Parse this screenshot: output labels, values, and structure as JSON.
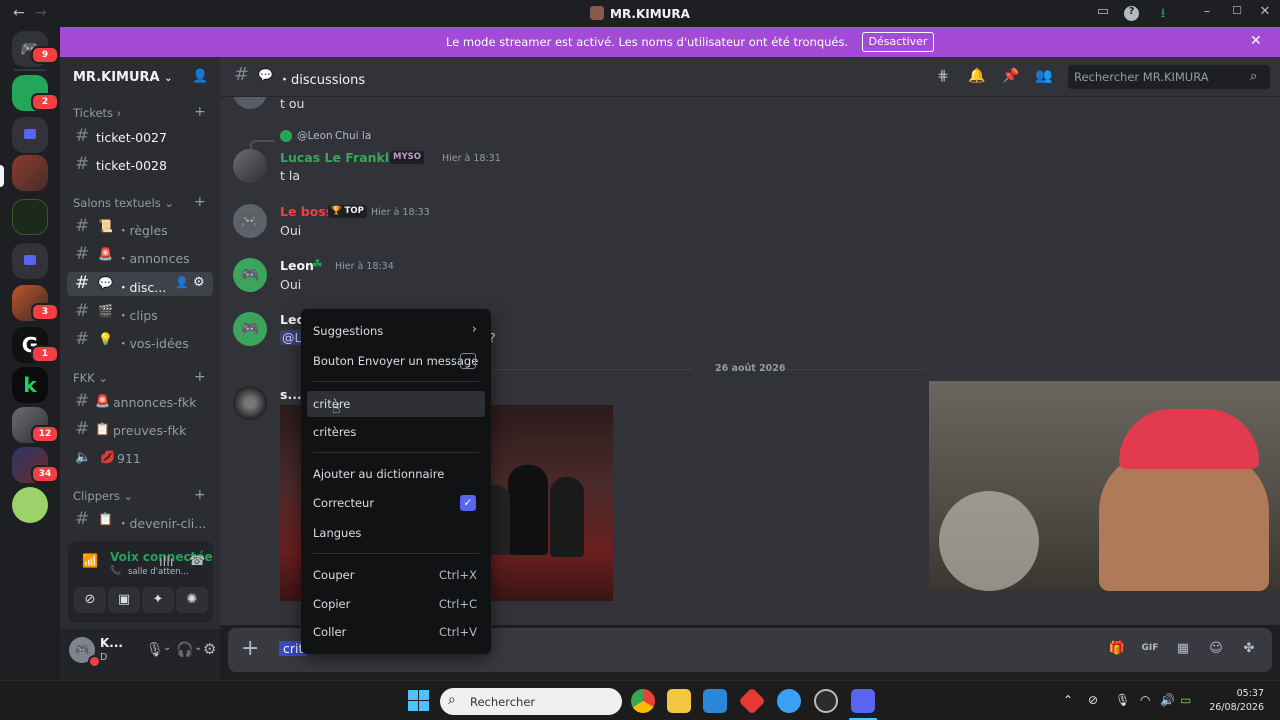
{
  "window": {
    "title": "MR.KIMURA",
    "back_icon": "←",
    "forward_icon": "→"
  },
  "banner": {
    "text": "Le mode streamer est activé. Les noms d'utilisateur ont été tronqués.",
    "button": "Désactiver",
    "close": "✕"
  },
  "rail": {
    "badges": [
      "9",
      "2",
      "3",
      "1",
      "12",
      "34"
    ]
  },
  "sidebar": {
    "guild_name": "MR.KIMURA",
    "tickets": {
      "label": "Tickets",
      "items": [
        "ticket-0027",
        "ticket-0028"
      ]
    },
    "salons": {
      "label": "Salons textuels",
      "items": [
        {
          "emoji": "📜",
          "name": "・règles"
        },
        {
          "emoji": "🚨",
          "name": "・annonces"
        },
        {
          "emoji": "💬",
          "name": "・disc..."
        },
        {
          "emoji": "🎬",
          "name": "・clips"
        },
        {
          "emoji": "💡",
          "name": "・vos-idées"
        }
      ]
    },
    "fkk": {
      "label": "FKK",
      "items": [
        {
          "emoji": "🚨",
          "name": "annonces-fkk"
        },
        {
          "emoji": "📋",
          "name": "preuves-fkk"
        },
        {
          "emoji": "💋",
          "name": "911"
        }
      ]
    },
    "clippers": {
      "label": "Clippers",
      "items": [
        {
          "emoji": "📋",
          "name": "・devenir-cli..."
        }
      ]
    },
    "voice": {
      "title": "Voix connectée",
      "subtitle": "salle d'atten..."
    },
    "user": {
      "name": "K...",
      "status": "D"
    }
  },
  "header": {
    "channel": "・discussions",
    "channel_emoji": "💬",
    "search_placeholder": "Rechercher MR.KIMURA"
  },
  "messages": {
    "m0_text": "t ou",
    "reply_to": "@Leon",
    "reply_text": "Chui la",
    "m1_author": "Lucas Le Franklint",
    "m1_tag": "MYSO",
    "m1_time": "Hier à 18:31",
    "m1_text": "t la",
    "m2_author": "Le boss",
    "m2_tag": "🏆 TOP",
    "m2_time": "Hier à 18:33",
    "m2_text": "Oui",
    "m3_author": "Leon",
    "m3_time": "Hier à 18:34",
    "m3_text": "Oui",
    "m4_author": "Leo",
    "m4_text": "@L",
    "m4_trail": "?",
    "date_divider": "26 août 2026",
    "m5_author": "s..."
  },
  "composer": {
    "text": "crit"
  },
  "context_menu": {
    "suggestions": "Suggestions",
    "send_button": "Bouton Envoyer un message",
    "suggestion_1": "critère",
    "suggestion_2": "critères",
    "add_dict": "Ajouter au dictionnaire",
    "spellcheck": "Correcteur",
    "languages": "Langues",
    "cut": "Couper",
    "cut_sc": "Ctrl+X",
    "copy": "Copier",
    "copy_sc": "Ctrl+C",
    "paste": "Coller",
    "paste_sc": "Ctrl+V"
  },
  "taskbar": {
    "search_placeholder": "Rechercher",
    "time": "05:37",
    "date": "26/08/2026"
  },
  "colors": {
    "banner": "#a34ad6",
    "online": "#23a55a",
    "blurple": "#5865f2",
    "leon_green": "#3ba55d",
    "boss_red": "#ed4245"
  }
}
